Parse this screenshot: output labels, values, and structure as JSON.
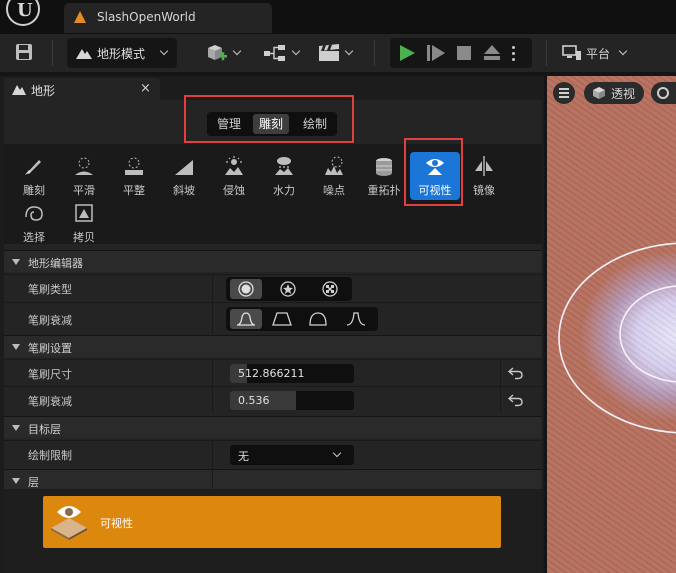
{
  "app": {
    "logo_letter": "U",
    "project_name": "SlashOpenWorld"
  },
  "toolbar": {
    "mode_label": "地形模式",
    "platform_label": "平台"
  },
  "panel": {
    "title": "地形",
    "close_glyph": "×",
    "mode_tabs": [
      "管理",
      "雕刻",
      "绘制"
    ],
    "active_mode": "雕刻",
    "tools": [
      {
        "label": "雕刻",
        "icon": "sculpt-icon"
      },
      {
        "label": "平滑",
        "icon": "smooth-icon"
      },
      {
        "label": "平整",
        "icon": "flatten-icon"
      },
      {
        "label": "斜坡",
        "icon": "ramp-icon"
      },
      {
        "label": "侵蚀",
        "icon": "erosion-icon"
      },
      {
        "label": "水力",
        "icon": "hydro-erosion-icon"
      },
      {
        "label": "噪点",
        "icon": "noise-icon"
      },
      {
        "label": "重拓扑",
        "icon": "retopologize-icon"
      },
      {
        "label": "可视性",
        "icon": "visibility-icon"
      },
      {
        "label": "镜像",
        "icon": "mirror-icon"
      },
      {
        "label": "选择",
        "icon": "select-icon"
      },
      {
        "label": "拷贝",
        "icon": "copy-icon"
      }
    ],
    "active_tool": "可视性",
    "sections": {
      "landscape_editor": "地形编辑器",
      "brush_settings": "笔刷设置",
      "target_layer": "目标层",
      "layers": "层"
    },
    "props": {
      "brush_type": "笔刷类型",
      "brush_falloff_type": "笔刷衰减",
      "brush_size": "笔刷尺寸",
      "brush_size_value": "512.866211",
      "brush_size_fraction": 0.14,
      "brush_falloff": "笔刷衰减",
      "brush_falloff_value": "0.536",
      "brush_falloff_fraction": 0.536,
      "paint_restriction": "绘制限制",
      "paint_restriction_value": "无"
    },
    "layer_item": "可视性"
  },
  "viewport": {
    "perspective_label": "透视"
  },
  "colors": {
    "accent_blue": "#1b76d8",
    "layer_orange": "#dc870e",
    "highlight_red": "#e04040",
    "play_green": "#4caf50"
  }
}
